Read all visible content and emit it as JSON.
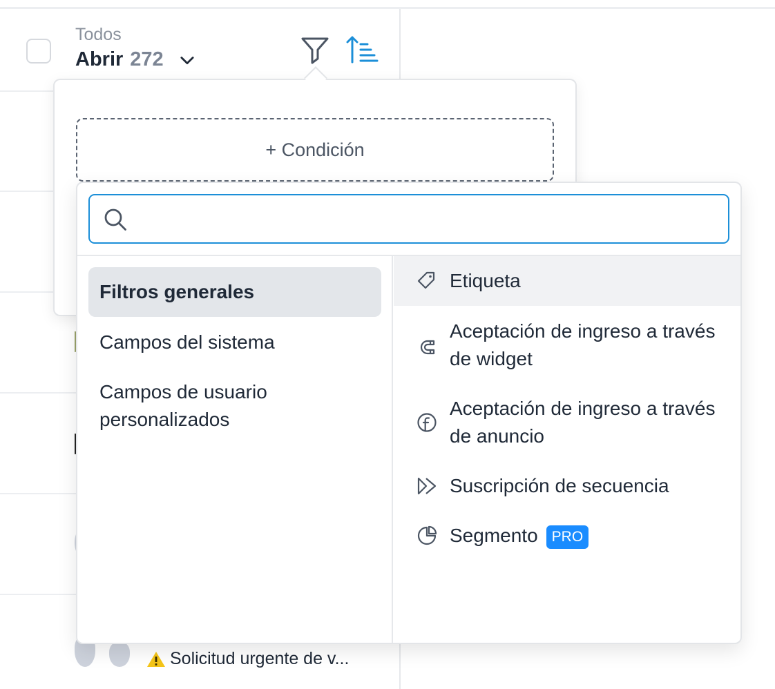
{
  "inbox": {
    "scope": "Todos",
    "status": "Abrir",
    "count": "272"
  },
  "conversation_preview": {
    "text": "Solicitud urgente de v..."
  },
  "filter": {
    "add_condition_label": "+ Condición",
    "search": {
      "value": "",
      "placeholder": ""
    },
    "categories": [
      {
        "label": "Filtros generales",
        "active": true
      },
      {
        "label": "Campos del sistema",
        "active": false
      },
      {
        "label": "Campos de usuario personalizados",
        "active": false
      }
    ],
    "options": [
      {
        "label": "Etiqueta",
        "icon": "tag-icon"
      },
      {
        "label": "Aceptación de ingreso a través de widget",
        "icon": "magnet-icon"
      },
      {
        "label": "Aceptación de ingreso a través de anuncio",
        "icon": "facebook-icon"
      },
      {
        "label": "Suscripción de secuencia",
        "icon": "double-chevron-right-icon"
      },
      {
        "label": "Segmento",
        "icon": "pie-chart-icon",
        "badge": "PRO"
      }
    ]
  },
  "colors": {
    "accent": "#1c8fd8",
    "pro_badge": "#1a8cff",
    "hover_bg": "#f1f2f4",
    "active_bg": "#e3e6ea",
    "warning": "#f5c518"
  }
}
